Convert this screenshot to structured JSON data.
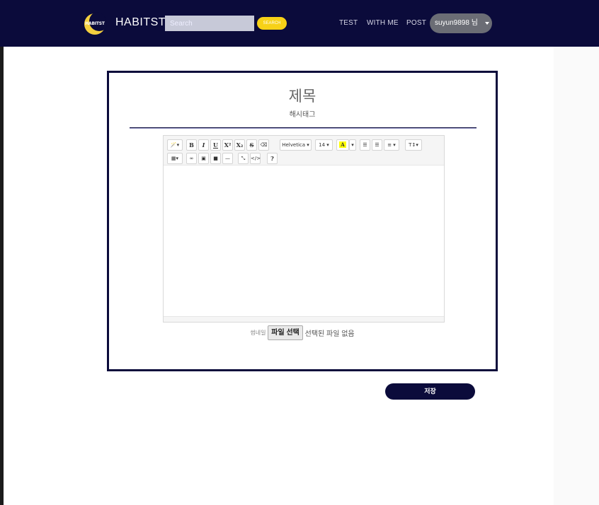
{
  "nav": {
    "logo_text": "HABITST",
    "brand": "HABITST",
    "search_placeholder": "Search",
    "search_button": "SEARCH",
    "links": [
      "TEST",
      "WITH ME",
      "POST"
    ],
    "user": "suyun9898 님"
  },
  "post": {
    "title": "제목",
    "tags": "해시태그"
  },
  "editor": {
    "toolbar": {
      "magic": "🪄▾",
      "bold": "B",
      "italic": "I",
      "underline": "U",
      "superscript": "X²",
      "subscript": "X₂",
      "strikethrough": "S",
      "eraser": "⌫",
      "font_family": "Helvetica ▾",
      "font_size": "14 ▾",
      "color_letter": "A",
      "color_caret": "▾",
      "ul": "☰",
      "ol": "☰",
      "align": "≡ ▾",
      "height": "T↕▾",
      "table": "▦▾",
      "link": "∞",
      "picture": "▣",
      "video": "■",
      "hr": "—",
      "fullscreen": "⤡",
      "codeview": "</>",
      "help": "?"
    }
  },
  "file": {
    "label": "썸네일",
    "button": "파일 선택",
    "status": "선택된 파일 없음"
  },
  "save_label": "저장",
  "colors": {
    "navy": "#0b0b3b",
    "accent_yellow": "#f7d117"
  }
}
